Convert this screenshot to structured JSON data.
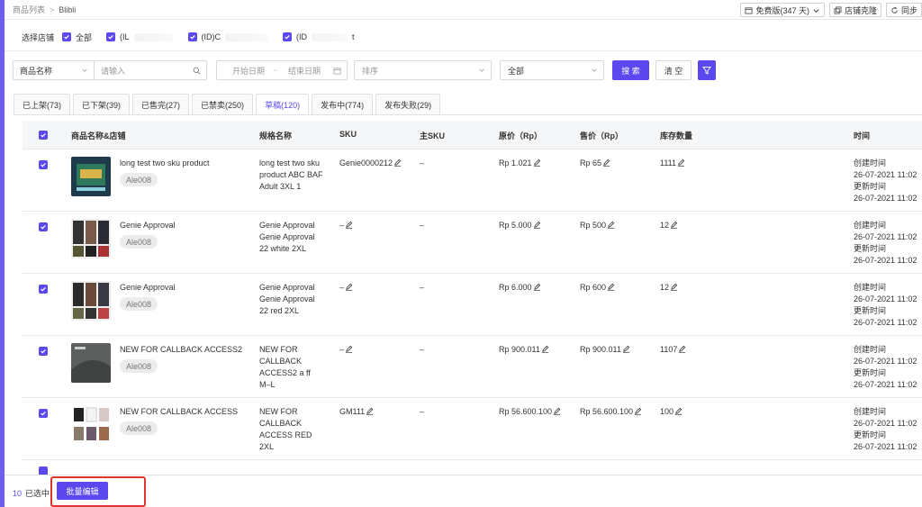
{
  "breadcrumb": {
    "parent": "商品列表",
    "current": "Blibli"
  },
  "top_actions": {
    "plan_label": "免费版(347 天)",
    "clone_label": "店铺克隆",
    "sync_label": "同步"
  },
  "store_filter": {
    "label": "选择店铺",
    "all_label": "全部",
    "stores": [
      {
        "label": "(IL"
      },
      {
        "label": "(ID)C"
      },
      {
        "label": "(ID"
      }
    ],
    "trailing": "t"
  },
  "filters": {
    "field_select": "商品名称",
    "input_placeholder": "请输入",
    "start_date": "开始日期",
    "date_sep": "~",
    "end_date": "结束日期",
    "sort_placeholder": "排序",
    "status_select": "全部",
    "search_label": "搜 索",
    "clear_label": "清 空"
  },
  "tabs": [
    {
      "label": "已上架(73)"
    },
    {
      "label": "已下架(39)"
    },
    {
      "label": "已售完(27)"
    },
    {
      "label": "已禁卖(250)"
    },
    {
      "label": "草稿(120)"
    },
    {
      "label": "发布中(774)"
    },
    {
      "label": "发布失败(29)"
    }
  ],
  "active_tab": "草稿(120)",
  "table": {
    "headers": {
      "product": "商品名称&店铺",
      "spec": "规格名称",
      "sku": "SKU",
      "parent_sku": "主SKU",
      "original_price": "原价（Rp）",
      "sale_price": "售价（Rp）",
      "stock": "库存数量",
      "time": "时间"
    },
    "rows": [
      {
        "name": "long test two sku product",
        "store": "Ale008",
        "spec": [
          "long test two sku",
          "product ABC BAF",
          "Adult 3XL 1"
        ],
        "sku": "Genie0000212",
        "parent_sku": "–",
        "original_price": "Rp 1.021",
        "sale_price": "Rp 65",
        "stock": "1111",
        "created_label": "创建时间",
        "created": "26-07-2021 11:02",
        "updated_label": "更新时间",
        "updated": "26-07-2021 11:02"
      },
      {
        "name": "Genie Approval",
        "store": "Ale008",
        "spec": [
          "Genie Approval",
          "Genie Approval",
          "22 white 2XL"
        ],
        "sku": "–",
        "parent_sku": "–",
        "original_price": "Rp 5.000",
        "sale_price": "Rp 500",
        "stock": "12",
        "created_label": "创建时间",
        "created": "26-07-2021 11:02",
        "updated_label": "更新时间",
        "updated": "26-07-2021 11:02"
      },
      {
        "name": "Genie Approval",
        "store": "Ale008",
        "spec": [
          "Genie Approval",
          "Genie Approval",
          "22 red 2XL"
        ],
        "sku": "–",
        "parent_sku": "–",
        "original_price": "Rp 6.000",
        "sale_price": "Rp 600",
        "stock": "12",
        "created_label": "创建时间",
        "created": "26-07-2021 11:02",
        "updated_label": "更新时间",
        "updated": "26-07-2021 11:02"
      },
      {
        "name": "NEW FOR CALLBACK ACCESS2",
        "store": "Ale008",
        "spec": [
          "NEW FOR",
          "CALLBACK",
          "ACCESS2 a ff",
          "M–L"
        ],
        "sku": "–",
        "parent_sku": "–",
        "original_price": "Rp 900.011",
        "sale_price": "Rp 900.011",
        "stock": "1107",
        "created_label": "创建时间",
        "created": "26-07-2021 11:02",
        "updated_label": "更新时间",
        "updated": "26-07-2021 11:02"
      },
      {
        "name": "NEW FOR CALLBACK ACCESS",
        "store": "Ale008",
        "spec": [
          "NEW FOR",
          "CALLBACK",
          "ACCESS RED",
          "2XL"
        ],
        "sku": "GM111",
        "parent_sku": "–",
        "original_price": "Rp 56.600.100",
        "sale_price": "Rp 56.600.100",
        "stock": "100",
        "created_label": "创建时间",
        "created": "26-07-2021 11:02",
        "updated_label": "更新时间",
        "updated": "26-07-2021 11:02"
      }
    ]
  },
  "footer": {
    "selected_count": "10",
    "selected_label": "已选中",
    "batch_edit_label": "批量编辑"
  },
  "colors": {
    "accent": "#5b48ee",
    "highlight": "#e0352b"
  }
}
